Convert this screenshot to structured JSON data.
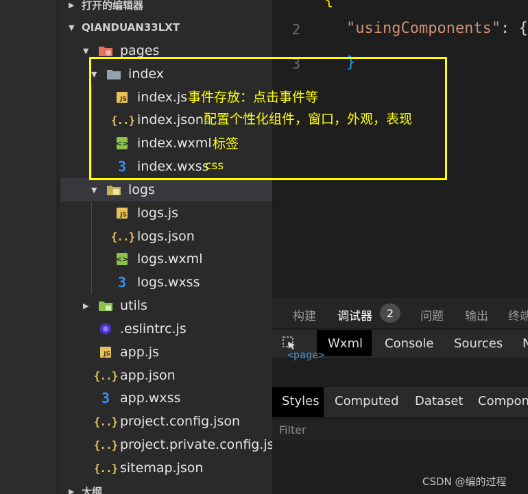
{
  "explorer": {
    "open_editors_label": "打开的编辑器",
    "project_label": "QIANDUAN33LXT",
    "outline_label": "大纲",
    "items": {
      "pages": "pages",
      "index": "index",
      "index_js": "index.js",
      "index_json": "index.json",
      "index_wxml": "index.wxml",
      "index_wxss": "index.wxss",
      "logs": "logs",
      "logs_js": "logs.js",
      "logs_json": "logs.json",
      "logs_wxml": "logs.wxml",
      "logs_wxss": "logs.wxss",
      "utils": "utils",
      "eslintrc": ".eslintrc.js",
      "app_js": "app.js",
      "app_json": "app.json",
      "app_wxss": "app.wxss",
      "project_config": "project.config.json",
      "project_private": "project.private.config.js...",
      "sitemap": "sitemap.json"
    }
  },
  "editor": {
    "line_numbers": [
      "2",
      "3"
    ],
    "line2_key": "\"usingComponents\"",
    "line2_rest": ": {",
    "line3": "}"
  },
  "bottom_panel": {
    "tabs": [
      "构建",
      "调试器",
      "问题",
      "输出",
      "终端"
    ],
    "debugger_badge": "2",
    "devtools_tabs": [
      "Wxml",
      "Console",
      "Sources",
      "Network"
    ],
    "page_fragment": "<page>",
    "styles_tabs": [
      "Styles",
      "Computed",
      "Dataset",
      "Component Data"
    ],
    "filter_placeholder": "Filter"
  },
  "annotations": {
    "js_note": "事件存放：点击事件等",
    "json_note": "配置个性化组件，窗口，外观，表现",
    "wxml_note": "标签",
    "wxss_note": "css"
  },
  "watermark": "CSDN @编的过程",
  "colors": {
    "highlight_box": "#ffff00",
    "js_icon": "#e8c15a",
    "wxml_icon": "#8bc34a",
    "wxss_icon": "#3b8eea",
    "folder_pages": "#e2725b",
    "folder_utils": "#8bc34a"
  }
}
